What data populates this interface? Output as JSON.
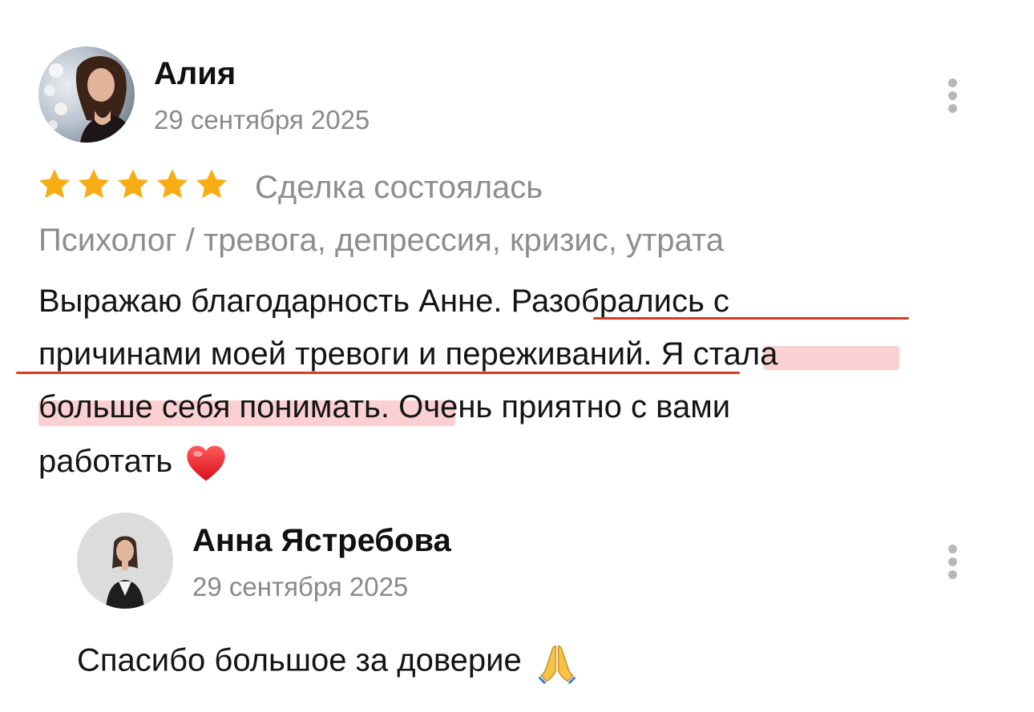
{
  "review": {
    "author": "Алия",
    "date": "29 сентября 2025",
    "rating": 5,
    "rating_max": 5,
    "status": "Сделка состоялась",
    "service": "Психолог / тревога, депрессия, кризис, утрата",
    "lines": [
      {
        "parts": [
          "Выражаю благодарность Анне. ",
          "Разобрались с"
        ]
      },
      {
        "parts": [
          "причинами моей тревоги и переживаний",
          ". ",
          "Я стала"
        ]
      },
      {
        "parts": [
          "больше себя понимать.",
          " Очень приятно с вами"
        ]
      },
      {
        "parts": [
          "работать"
        ]
      }
    ],
    "end_emoji": "red-heart-emoji"
  },
  "reply": {
    "author": "Анна Ястребова",
    "date": "29 сентября 2025",
    "text": "Спасибо большое за доверие",
    "end_emoji": "folded-hands-emoji"
  },
  "colors": {
    "star": "#f9ad15",
    "underline": "#d83a2a",
    "highlight": "#f5aaaf",
    "muted_text": "#8d8d8d"
  }
}
